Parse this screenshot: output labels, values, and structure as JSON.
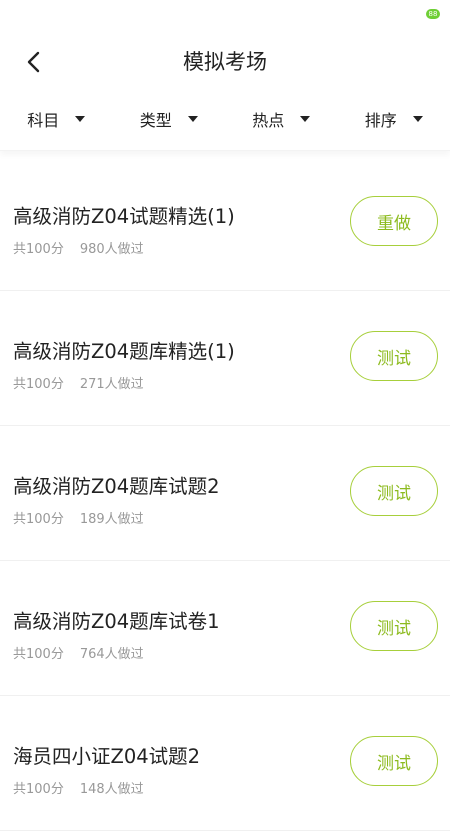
{
  "status_bar": {
    "battery": "88"
  },
  "header": {
    "title": "模拟考场"
  },
  "filters": [
    {
      "label": "科目"
    },
    {
      "label": "类型"
    },
    {
      "label": "热点"
    },
    {
      "label": "排序"
    }
  ],
  "items": [
    {
      "title": "高级消防Z04试题精选(1)",
      "score": "共100分",
      "count": "980人做过",
      "button": "重做"
    },
    {
      "title": "高级消防Z04题库精选(1)",
      "score": "共100分",
      "count": "271人做过",
      "button": "测试"
    },
    {
      "title": "高级消防Z04题库试题2",
      "score": "共100分",
      "count": "189人做过",
      "button": "测试"
    },
    {
      "title": "高级消防Z04题库试卷1",
      "score": "共100分",
      "count": "764人做过",
      "button": "测试"
    },
    {
      "title": "海员四小证Z04试题2",
      "score": "共100分",
      "count": "148人做过",
      "button": "测试"
    }
  ],
  "colors": {
    "accent": "#a7cf3b",
    "accent_text": "#8dbb1f",
    "battery": "#6fcf36"
  }
}
